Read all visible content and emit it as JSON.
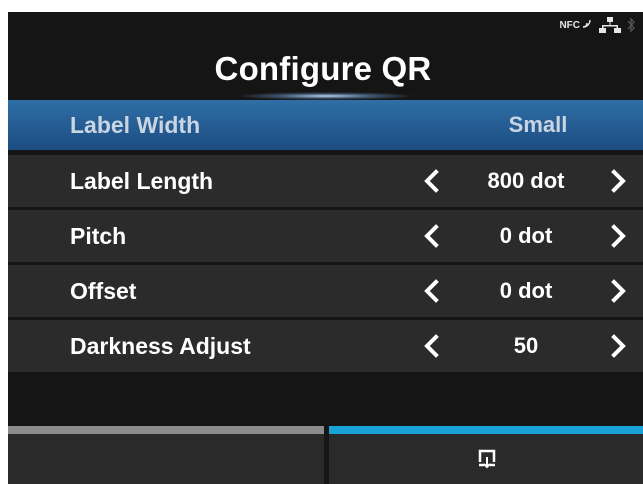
{
  "header": {
    "title": "Configure QR",
    "status_icons": [
      "nfc-icon",
      "network-icon",
      "bluetooth-icon"
    ],
    "nfc_label": "NFC"
  },
  "settings": {
    "rows": [
      {
        "label": "Label Width",
        "value": "Small",
        "selected": true,
        "adjustable": false
      },
      {
        "label": "Label Length",
        "value": "800 dot",
        "selected": false,
        "adjustable": true
      },
      {
        "label": "Pitch",
        "value": "0 dot",
        "selected": false,
        "adjustable": true
      },
      {
        "label": "Offset",
        "value": "0 dot",
        "selected": false,
        "adjustable": true
      },
      {
        "label": "Darkness Adjust",
        "value": "50",
        "selected": false,
        "adjustable": true
      }
    ]
  },
  "bottom_bar": {
    "tabs": [
      {
        "name": "left-tab",
        "icon": "",
        "accent": "#8c8c8c"
      },
      {
        "name": "test-print-tab",
        "icon": "test-print-icon",
        "accent": "#1aa3d8"
      }
    ]
  },
  "colors": {
    "background": "#151515",
    "row": "#2b2b2b",
    "selected_row": "#2a5f96",
    "active_tab_accent": "#1aa3d8"
  }
}
